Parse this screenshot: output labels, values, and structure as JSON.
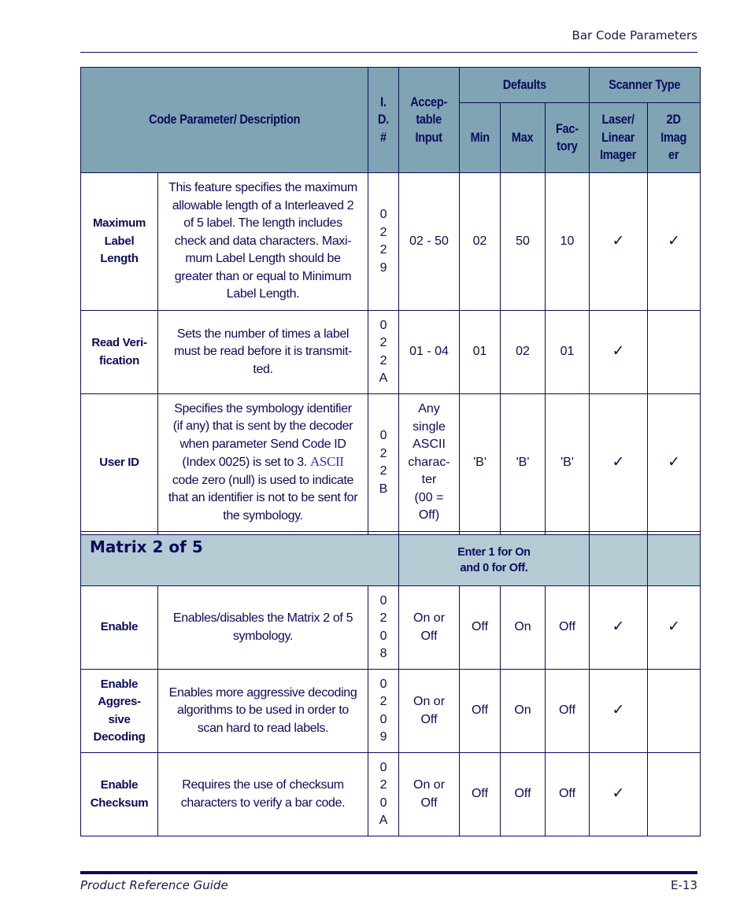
{
  "header": {
    "running_title": "Bar Code Parameters"
  },
  "table": {
    "headers": {
      "code_param": "Code Parameter/ Description",
      "id_lines": [
        "I.",
        "D.",
        "#"
      ],
      "accept_lines": [
        "Accep-",
        "table",
        "Input"
      ],
      "defaults": "Defaults",
      "scanner_type": "Scanner Type",
      "min": "Min",
      "max": "Max",
      "factory_lines": [
        "Fac-",
        "tory"
      ],
      "laser_lines": [
        "Laser/",
        "Linear",
        "Imager"
      ],
      "imager2d_lines": [
        "2D",
        "Imag",
        "er"
      ]
    },
    "rows_a": [
      {
        "name_lines": [
          "Maximum",
          "Label",
          "Length"
        ],
        "desc_lines": [
          "This feature specifies the maximum",
          "allowable length of a Interleaved 2",
          "of 5 label. The length includes",
          "check and data characters. Maxi-",
          "mum Label Length should be",
          "greater than or equal to Minimum",
          "Label Length."
        ],
        "id_chars": [
          "0",
          "2",
          "2",
          "9"
        ],
        "accept_lines": [
          "02 - 50"
        ],
        "min": "02",
        "max": "50",
        "factory": "10",
        "laser": "✓",
        "imager2d": "✓"
      },
      {
        "name_lines": [
          "Read Veri-",
          "fication"
        ],
        "desc_lines": [
          "Sets the number of times a label",
          "must be read before it is transmit-",
          "ted."
        ],
        "id_chars": [
          "0",
          "2",
          "2",
          "A"
        ],
        "accept_lines": [
          "01 - 04"
        ],
        "min": "01",
        "max": "02",
        "factory": "01",
        "laser": "✓",
        "imager2d": ""
      },
      {
        "name_lines": [
          "User ID"
        ],
        "desc_lines": [
          "Specifies the symbology identifier",
          "(if any) that is sent by the decoder",
          "when parameter Send Code ID"
        ],
        "desc_line4_pre": "(Index 0025) is set to 3. ",
        "desc_line4_serif": "ASCII",
        "desc_lines_after": [
          "code zero (null) is used to indicate",
          "that an identifier is not to be sent for",
          "the symbology."
        ],
        "id_chars": [
          "0",
          "2",
          "2",
          "B"
        ],
        "accept_lines": [
          "Any",
          "single",
          "ASCII",
          "charac-",
          "ter",
          "(00 =",
          "Off)"
        ],
        "min": "'B'",
        "max": "'B'",
        "factory": "'B'",
        "laser": "✓",
        "imager2d": "✓"
      }
    ],
    "section": {
      "title": "Matrix 2 of 5",
      "note_lines": [
        "Enter 1 for On",
        "and 0 for Off."
      ]
    },
    "rows_b": [
      {
        "name_lines": [
          "Enable"
        ],
        "desc_lines": [
          "Enables/disables the Matrix 2 of 5",
          "symbology."
        ],
        "id_chars": [
          "0",
          "2",
          "0",
          "8"
        ],
        "accept_lines": [
          "On or",
          "Off"
        ],
        "min": "Off",
        "max": "On",
        "factory": "Off",
        "laser": "✓",
        "imager2d": "✓"
      },
      {
        "name_lines": [
          "Enable",
          "Aggres-",
          "sive",
          "Decoding"
        ],
        "desc_lines": [
          "Enables more aggressive decoding",
          "algorithms to be used in order to",
          "scan hard to read labels."
        ],
        "id_chars": [
          "0",
          "2",
          "0",
          "9"
        ],
        "accept_lines": [
          "On or",
          "Off"
        ],
        "min": "Off",
        "max": "On",
        "factory": "Off",
        "laser": "✓",
        "imager2d": ""
      },
      {
        "name_lines": [
          "Enable",
          "Checksum"
        ],
        "desc_lines": [
          "Requires the use of checksum",
          "characters to verify a bar code."
        ],
        "id_chars": [
          "0",
          "2",
          "0",
          "A"
        ],
        "accept_lines": [
          "On or",
          "Off"
        ],
        "min": "Off",
        "max": "Off",
        "factory": "Off",
        "laser": "✓",
        "imager2d": ""
      }
    ]
  },
  "footer": {
    "guide_title": "Product Reference Guide",
    "page_number": "E-13"
  }
}
